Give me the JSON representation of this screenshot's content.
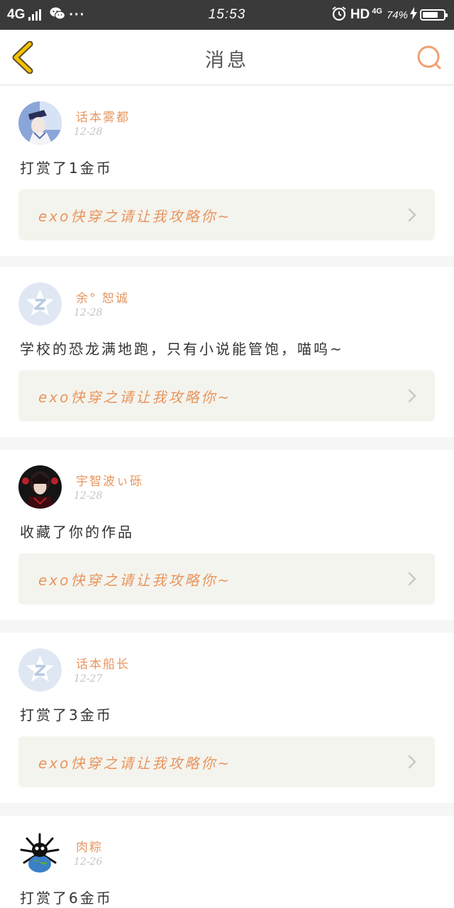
{
  "status_bar": {
    "network": "4G",
    "time": "15:53",
    "hd": "HD",
    "net_small": "4G",
    "battery_percent": "74%",
    "battery_level": 0.74
  },
  "header": {
    "title": "消息"
  },
  "colors": {
    "accent": "#e8955e",
    "back_arrow": "#f2c200"
  },
  "messages": [
    {
      "username": "话本雾都",
      "date": "12-28",
      "text": "打赏了1金币",
      "work_title": "exo快穿之请让我攻略你~",
      "avatar": "anime-portrait-avatar"
    },
    {
      "username": "余° 恕诚",
      "date": "12-28",
      "text": "学校的恐龙满地跑，只有小说能管饱，喵呜~",
      "work_title": "exo快穿之请让我攻略你~",
      "avatar": "default-q-avatar"
    },
    {
      "username": "宇智波ぃ砾",
      "date": "12-28",
      "text": "收藏了你的作品",
      "work_title": "exo快穿之请让我攻略你~",
      "avatar": "dark-portrait-avatar"
    },
    {
      "username": "话本船长",
      "date": "12-27",
      "text": "打赏了3金币",
      "work_title": "exo快穿之请让我攻略你~",
      "avatar": "default-q-avatar"
    },
    {
      "username": "肉粽",
      "date": "12-26",
      "text": "打赏了6金币",
      "avatar": "spiky-creature-avatar"
    }
  ]
}
